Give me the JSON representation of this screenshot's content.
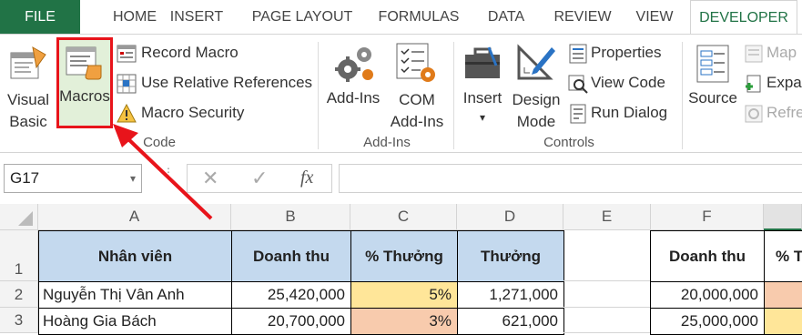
{
  "tabs": [
    "FILE",
    "HOME",
    "INSERT",
    "PAGE LAYOUT",
    "FORMULAS",
    "DATA",
    "REVIEW",
    "VIEW",
    "DEVELOPER"
  ],
  "ribbon": {
    "code": {
      "visual_basic": [
        "Visual",
        "Basic"
      ],
      "macros": "Macros",
      "record_macro": "Record Macro",
      "relative_refs": "Use Relative References",
      "macro_security": "Macro Security",
      "group": "Code"
    },
    "addins": {
      "addins": "Add-Ins",
      "com_addins": [
        "COM",
        "Add-Ins"
      ],
      "group": "Add-Ins"
    },
    "controls": {
      "insert": "Insert",
      "design_mode": [
        "Design",
        "Mode"
      ],
      "properties": "Properties",
      "view_code": "View Code",
      "run_dialog": "Run Dialog",
      "group": "Controls"
    },
    "xml": {
      "source": "Source",
      "map": "Map",
      "expand": "Expa",
      "refresh": "Refre"
    }
  },
  "formula_bar": {
    "name_box": "G17",
    "fx": "fx",
    "value": ""
  },
  "columns": [
    "A",
    "B",
    "C",
    "D",
    "E",
    "F"
  ],
  "rows": [
    "1",
    "2",
    "3"
  ],
  "headers": {
    "a": "Nhân viên",
    "b": "Doanh thu",
    "c": "% Thưởng",
    "d": "Thưởng",
    "f": "Doanh thu",
    "g": "% T"
  },
  "data": [
    {
      "name": "Nguyễn Thị Vân Anh",
      "revenue": "25,420,000",
      "pct": "5%",
      "bonus": "1,271,000",
      "f": "20,000,000"
    },
    {
      "name": "Hoàng Gia Bách",
      "revenue": "20,700,000",
      "pct": "3%",
      "bonus": "621,000",
      "f": "25,000,000"
    }
  ],
  "colors": {
    "file_tab": "#217346",
    "header_fill": "#c4d9ee",
    "pct_yellow": "#ffe699",
    "pct_orange": "#f8cbad",
    "highlight": "#e2f0d9",
    "annotation": "#e8141b"
  }
}
